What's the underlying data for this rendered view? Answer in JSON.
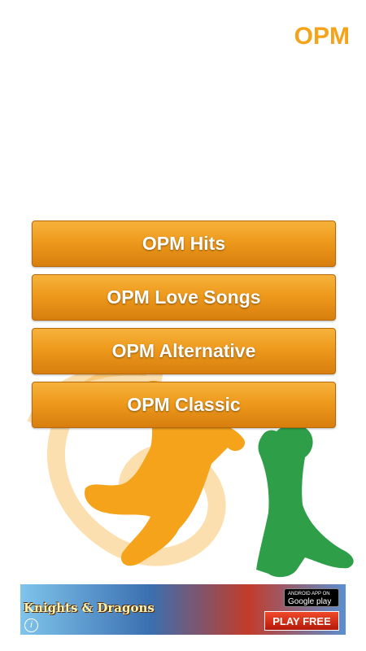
{
  "header": {
    "title": "OPM"
  },
  "menu": {
    "items": [
      {
        "label": "OPM Hits"
      },
      {
        "label": "OPM Love Songs"
      },
      {
        "label": "OPM Alternative"
      },
      {
        "label": "OPM Classic"
      }
    ]
  },
  "ad": {
    "brand": "Knights & Dragons",
    "store_small": "ANDROID APP ON",
    "store_big": "Google play",
    "cta": "PLAY FREE",
    "info_glyph": "i"
  },
  "colors": {
    "accent": "#f5a31a",
    "button_top": "#f6b23c",
    "button_bottom": "#d87e0e",
    "silhouette_orange": "#f5a31a",
    "silhouette_green": "#2e9e48"
  }
}
